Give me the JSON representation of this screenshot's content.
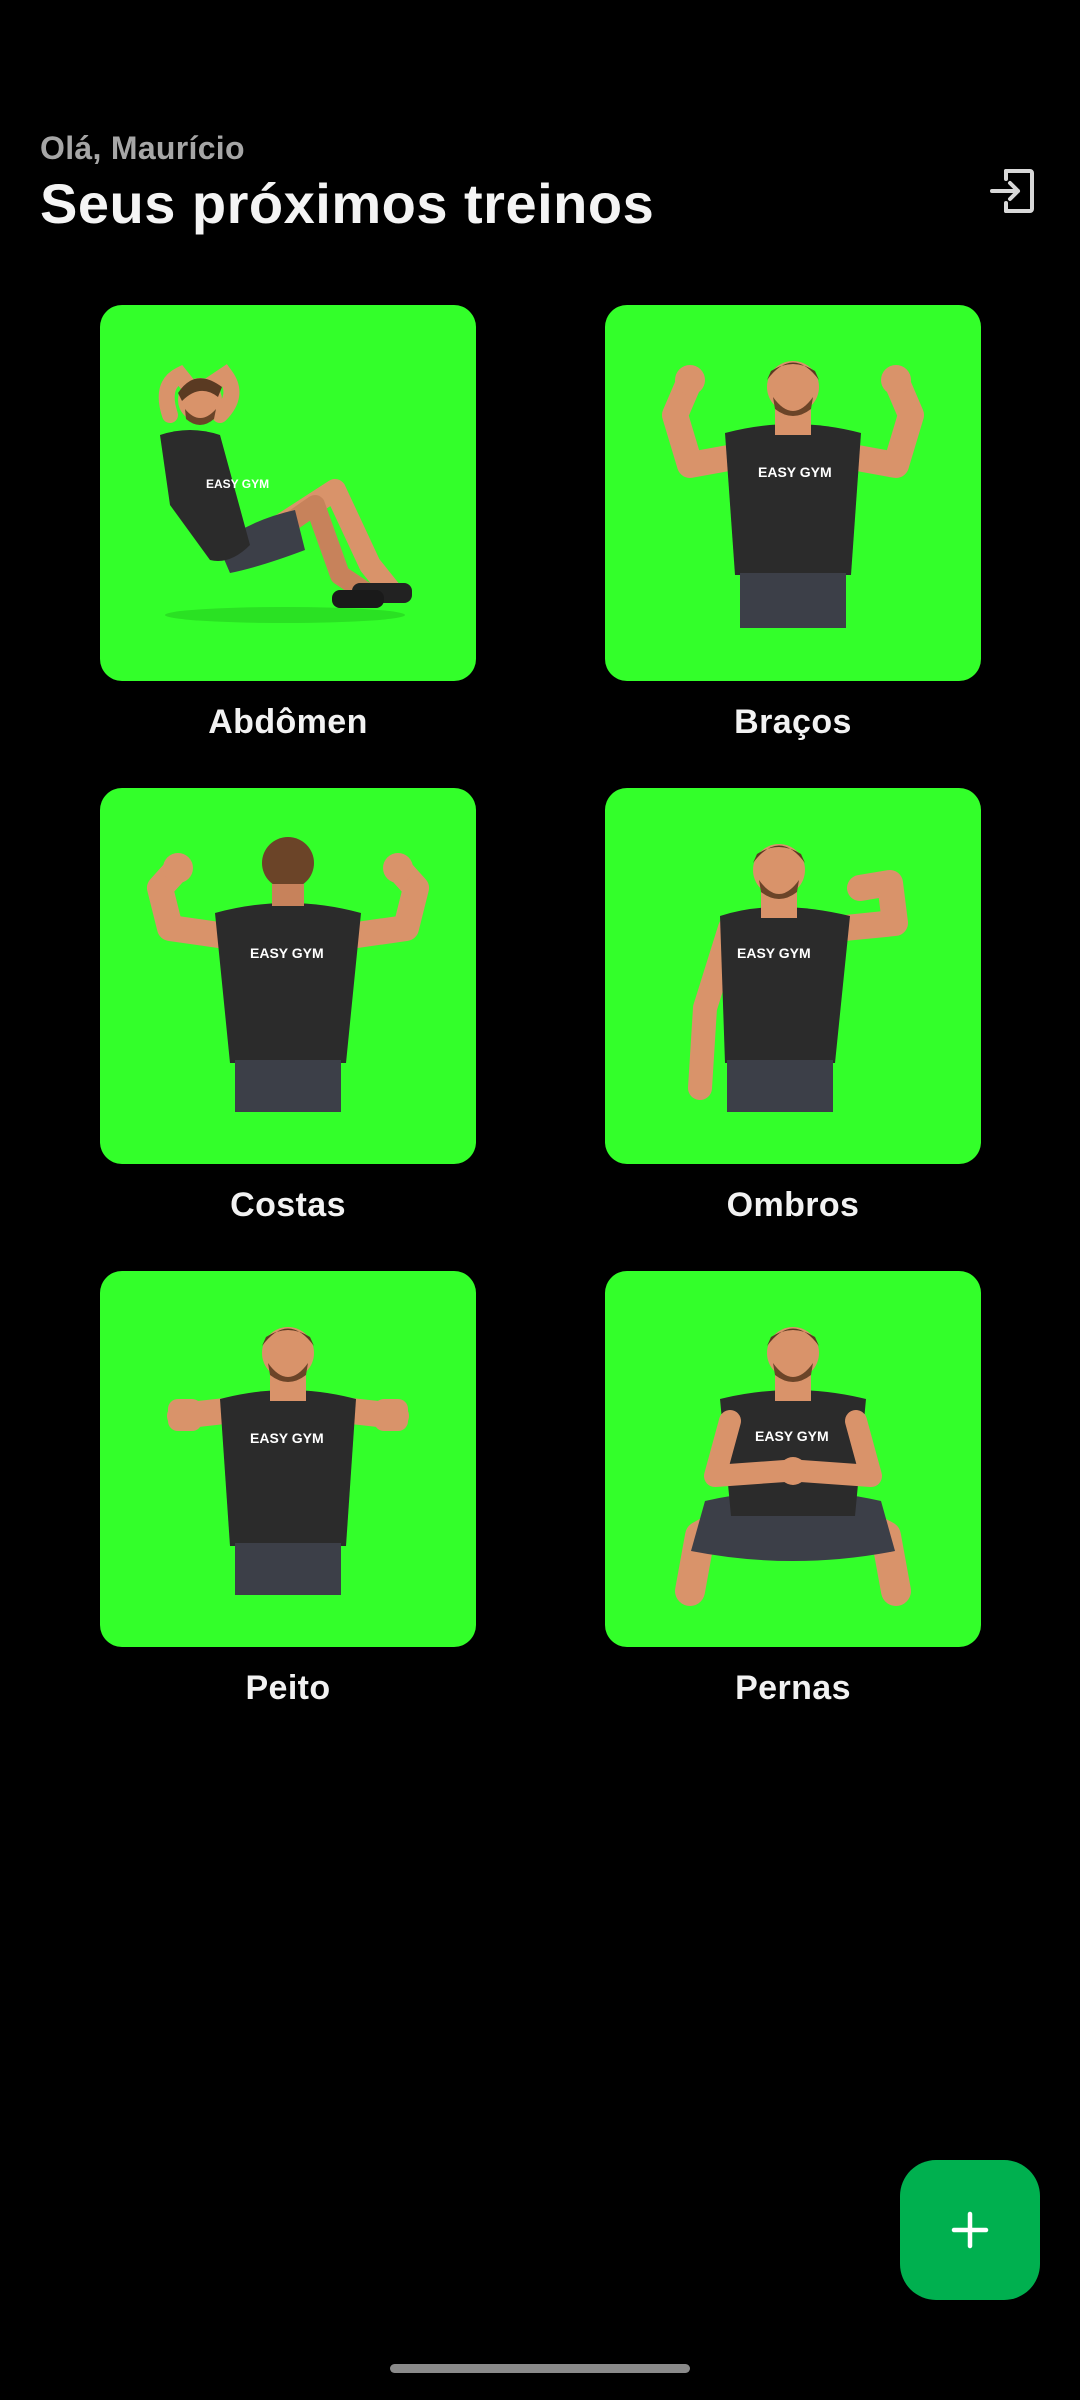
{
  "header": {
    "greeting": "Olá, Maurício",
    "title": "Seus próximos treinos",
    "logout_icon": "logout-icon"
  },
  "colors": {
    "background": "#000000",
    "tile": "#33ff2a",
    "fab": "#00b04f",
    "shirt": "#2b2b2b",
    "skin": "#d9936a",
    "shorts": "#3c3f48"
  },
  "shirt_brand": "EASY GYM",
  "workouts": [
    {
      "label": "Abdômen",
      "pose": "situp"
    },
    {
      "label": "Braços",
      "pose": "front-flex"
    },
    {
      "label": "Costas",
      "pose": "back-flex"
    },
    {
      "label": "Ombros",
      "pose": "one-arm-flex"
    },
    {
      "label": "Peito",
      "pose": "arms-forward"
    },
    {
      "label": "Pernas",
      "pose": "squat"
    }
  ],
  "fab": {
    "icon": "plus-icon"
  }
}
